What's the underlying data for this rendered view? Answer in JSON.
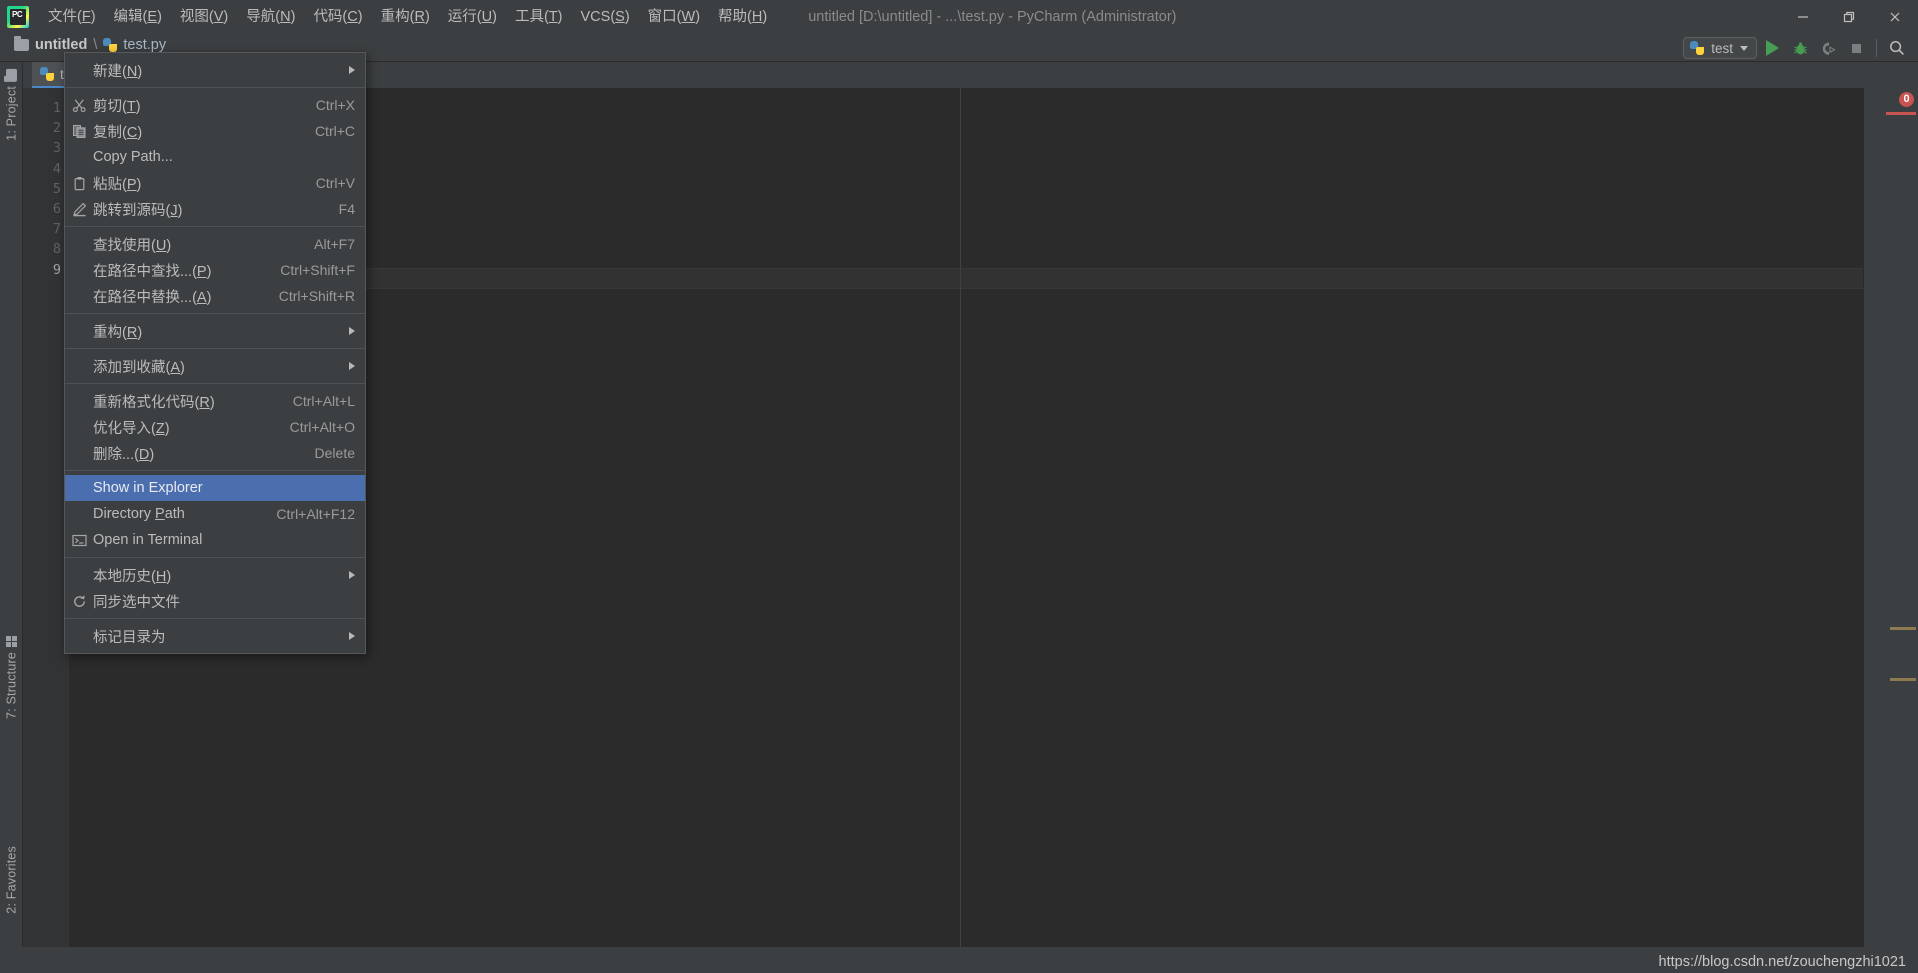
{
  "window": {
    "title": "untitled [D:\\untitled] - ...\\test.py - PyCharm (Administrator)",
    "logo_text": "PC",
    "controls": {
      "minimize": "—",
      "restore": "❐",
      "close": "×"
    }
  },
  "menubar": {
    "items": [
      {
        "label": "文件(F)",
        "name": "menu-file"
      },
      {
        "label": "编辑(E)",
        "name": "menu-edit"
      },
      {
        "label": "视图(V)",
        "name": "menu-view"
      },
      {
        "label": "导航(N)",
        "name": "menu-navigate"
      },
      {
        "label": "代码(C)",
        "name": "menu-code"
      },
      {
        "label": "重构(R)",
        "name": "menu-refactor"
      },
      {
        "label": "运行(U)",
        "name": "menu-run"
      },
      {
        "label": "工具(T)",
        "name": "menu-tools"
      },
      {
        "label": "VCS(S)",
        "name": "menu-vcs"
      },
      {
        "label": "窗口(W)",
        "name": "menu-window"
      },
      {
        "label": "帮助(H)",
        "name": "menu-help"
      }
    ]
  },
  "toolbar": {
    "breadcrumb": {
      "project": "untitled",
      "separator": "\\",
      "file": "test.py"
    },
    "run_config": "test",
    "buttons": {
      "run": "run",
      "debug": "debug",
      "coverage": "run-with-coverage",
      "stop": "stop",
      "search": "search-everywhere"
    }
  },
  "tool_windows": {
    "project": {
      "label": "1: Project",
      "index": "1"
    },
    "structure": {
      "label": "7: Structure",
      "index": "7"
    },
    "favorites": {
      "label": "2: Favorites",
      "index": "2"
    }
  },
  "editor": {
    "tab": {
      "filename": "test.py"
    },
    "line_numbers": [
      "1",
      "2",
      "3",
      "4",
      "5",
      "6",
      "7",
      "8",
      "9"
    ],
    "current_line": "9",
    "error_count": "0",
    "accent_color": "#4b6eaf",
    "background": "#2b2b2b",
    "error_color": "#c75450"
  },
  "context_menu": {
    "items": [
      {
        "label": "新建(N)",
        "mnemonic": "N",
        "shortcut": "",
        "submenu": true,
        "icon": "",
        "separator_after": true,
        "selected": false,
        "name": "ctx-new"
      },
      {
        "label": "剪切(T)",
        "mnemonic": "T",
        "shortcut": "Ctrl+X",
        "submenu": false,
        "icon": "scissors-icon",
        "separator_after": false,
        "selected": false,
        "name": "ctx-cut"
      },
      {
        "label": "复制(C)",
        "mnemonic": "C",
        "shortcut": "Ctrl+C",
        "submenu": false,
        "icon": "copy-icon",
        "separator_after": false,
        "selected": false,
        "name": "ctx-copy"
      },
      {
        "label": "Copy Path...",
        "mnemonic": "",
        "shortcut": "",
        "submenu": false,
        "icon": "",
        "separator_after": false,
        "selected": false,
        "name": "ctx-copy-path"
      },
      {
        "label": "粘贴(P)",
        "mnemonic": "P",
        "shortcut": "Ctrl+V",
        "submenu": false,
        "icon": "clipboard-icon",
        "separator_after": false,
        "selected": false,
        "name": "ctx-paste"
      },
      {
        "label": "跳转到源码(J)",
        "mnemonic": "J",
        "shortcut": "F4",
        "submenu": false,
        "icon": "pencil-icon",
        "separator_after": true,
        "selected": false,
        "name": "ctx-jump-to-source"
      },
      {
        "label": "查找使用(U)",
        "mnemonic": "U",
        "shortcut": "Alt+F7",
        "submenu": false,
        "icon": "",
        "separator_after": false,
        "selected": false,
        "name": "ctx-find-usages"
      },
      {
        "label": "在路径中查找...(P)",
        "mnemonic": "P",
        "shortcut": "Ctrl+Shift+F",
        "submenu": false,
        "icon": "",
        "separator_after": false,
        "selected": false,
        "name": "ctx-find-in-path"
      },
      {
        "label": "在路径中替换...(A)",
        "mnemonic": "A",
        "shortcut": "Ctrl+Shift+R",
        "submenu": false,
        "icon": "",
        "separator_after": true,
        "selected": false,
        "name": "ctx-replace-in-path"
      },
      {
        "label": "重构(R)",
        "mnemonic": "R",
        "shortcut": "",
        "submenu": true,
        "icon": "",
        "separator_after": true,
        "selected": false,
        "name": "ctx-refactor"
      },
      {
        "label": "添加到收藏(A)",
        "mnemonic": "A",
        "shortcut": "",
        "submenu": true,
        "icon": "",
        "separator_after": true,
        "selected": false,
        "name": "ctx-add-to-favorites"
      },
      {
        "label": "重新格式化代码(R)",
        "mnemonic": "R",
        "shortcut": "Ctrl+Alt+L",
        "submenu": false,
        "icon": "",
        "separator_after": false,
        "selected": false,
        "name": "ctx-reformat-code"
      },
      {
        "label": "优化导入(Z)",
        "mnemonic": "Z",
        "shortcut": "Ctrl+Alt+O",
        "submenu": false,
        "icon": "",
        "separator_after": false,
        "selected": false,
        "name": "ctx-optimize-imports"
      },
      {
        "label": "删除...(D)",
        "mnemonic": "D",
        "shortcut": "Delete",
        "submenu": false,
        "icon": "",
        "separator_after": true,
        "selected": false,
        "name": "ctx-delete"
      },
      {
        "label": "Show in Explorer",
        "mnemonic": "",
        "shortcut": "",
        "submenu": false,
        "icon": "",
        "separator_after": false,
        "selected": true,
        "name": "ctx-show-in-explorer"
      },
      {
        "label": "Directory Path",
        "mnemonic": "P",
        "shortcut": "Ctrl+Alt+F12",
        "submenu": false,
        "icon": "",
        "separator_after": false,
        "selected": false,
        "name": "ctx-directory-path"
      },
      {
        "label": "Open in Terminal",
        "mnemonic": "",
        "shortcut": "",
        "submenu": false,
        "icon": "terminal-icon",
        "separator_after": true,
        "selected": false,
        "name": "ctx-open-in-terminal"
      },
      {
        "label": "本地历史(H)",
        "mnemonic": "H",
        "shortcut": "",
        "submenu": true,
        "icon": "",
        "separator_after": false,
        "selected": false,
        "name": "ctx-local-history"
      },
      {
        "label": "同步选中文件",
        "mnemonic": "",
        "shortcut": "",
        "submenu": false,
        "icon": "refresh-icon",
        "separator_after": true,
        "selected": false,
        "name": "ctx-synchronize"
      },
      {
        "label": "标记目录为",
        "mnemonic": "",
        "shortcut": "",
        "submenu": true,
        "icon": "",
        "separator_after": false,
        "selected": false,
        "name": "ctx-mark-directory-as"
      }
    ]
  },
  "watermark": {
    "url": "https://blog.csdn.net/zouchengzhi1021"
  }
}
